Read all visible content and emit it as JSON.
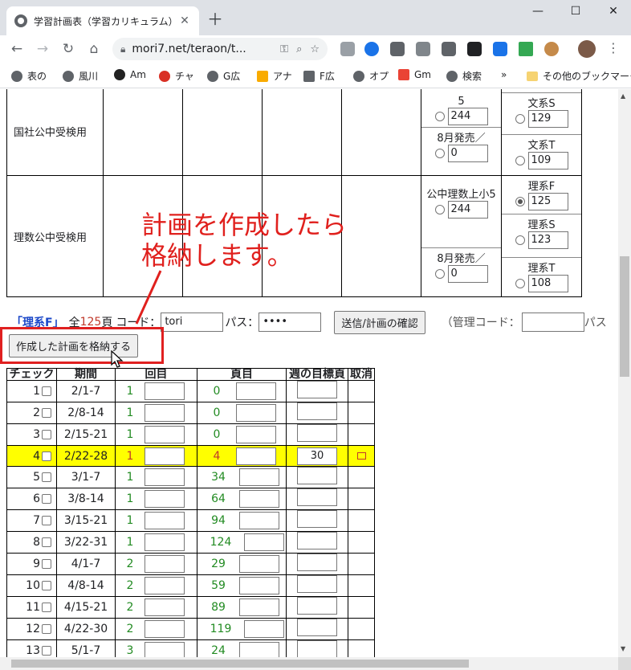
{
  "browser": {
    "tab_title": "学習計画表（学習カリキュラム）",
    "url": "mori7.net/teraon/t...",
    "bookmarks": [
      "表の",
      "風川",
      "Am",
      "チャ",
      "G広",
      "アナ",
      "F広",
      "オプ",
      "Gm",
      "検索",
      "»",
      "その他のブックマーク"
    ]
  },
  "grid": {
    "rows": [
      {
        "label": "国社公中受検用",
        "left_opts": [
          {
            "label": "5",
            "value": "244",
            "selected": false
          },
          {
            "label": "8月発売／",
            "value": "0",
            "selected": false
          }
        ],
        "right_opts": [
          {
            "label": "文系S",
            "value": "129",
            "selected": false
          },
          {
            "label": "文系T",
            "value": "109",
            "selected": false
          }
        ]
      },
      {
        "label": "理数公中受検用",
        "left_opts": [
          {
            "label": "公中理数上小5",
            "value": "244",
            "selected": false
          },
          {
            "label": "8月発売／",
            "value": "0",
            "selected": false
          }
        ],
        "right_opts": [
          {
            "label": "理系F",
            "value": "125",
            "selected": true
          },
          {
            "label": "理系S",
            "value": "123",
            "selected": false
          },
          {
            "label": "理系T",
            "value": "108",
            "selected": false
          }
        ]
      }
    ]
  },
  "form": {
    "course": "「理系F」",
    "total_prefix": "全",
    "total_pages": "125",
    "total_suffix": "頁",
    "code_label": "コード：",
    "code_value": "tori",
    "pass_label": "パス：",
    "pass_value": "••••",
    "submit_label": "送信/計画の確認",
    "admin_code_label": "（管理コード：",
    "admin_pass_label": "パス",
    "store_button": "作成した計画を格納する"
  },
  "annotation": {
    "line1": "計画を作成したら",
    "line2": "格納します。"
  },
  "schedule": {
    "headers": [
      "チェック",
      "期間",
      "回目",
      "頁目",
      "週の目標頁",
      "取消"
    ],
    "rows": [
      {
        "no": "1",
        "period": "2/1-7",
        "kai": "1",
        "page": "0",
        "goal": "",
        "hl": false
      },
      {
        "no": "2",
        "period": "2/8-14",
        "kai": "1",
        "page": "0",
        "goal": "",
        "hl": false
      },
      {
        "no": "3",
        "period": "2/15-21",
        "kai": "1",
        "page": "0",
        "goal": "",
        "hl": false
      },
      {
        "no": "4",
        "period": "2/22-28",
        "kai": "1",
        "page": "4",
        "goal": "30",
        "hl": true
      },
      {
        "no": "5",
        "period": "3/1-7",
        "kai": "1",
        "page": "34",
        "goal": "",
        "hl": false
      },
      {
        "no": "6",
        "period": "3/8-14",
        "kai": "1",
        "page": "64",
        "goal": "",
        "hl": false
      },
      {
        "no": "7",
        "period": "3/15-21",
        "kai": "1",
        "page": "94",
        "goal": "",
        "hl": false
      },
      {
        "no": "8",
        "period": "3/22-31",
        "kai": "1",
        "page": "124",
        "goal": "",
        "hl": false
      },
      {
        "no": "9",
        "period": "4/1-7",
        "kai": "2",
        "page": "29",
        "goal": "",
        "hl": false
      },
      {
        "no": "10",
        "period": "4/8-14",
        "kai": "2",
        "page": "59",
        "goal": "",
        "hl": false
      },
      {
        "no": "11",
        "period": "4/15-21",
        "kai": "2",
        "page": "89",
        "goal": "",
        "hl": false
      },
      {
        "no": "12",
        "period": "4/22-30",
        "kai": "2",
        "page": "119",
        "goal": "",
        "hl": false
      },
      {
        "no": "13",
        "period": "5/1-7",
        "kai": "3",
        "page": "24",
        "goal": "",
        "hl": false
      }
    ]
  }
}
